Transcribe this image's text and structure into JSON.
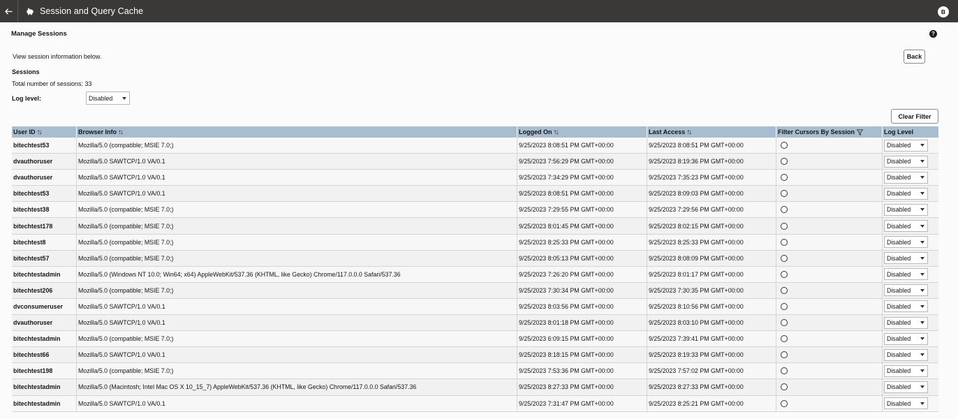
{
  "header": {
    "title": "Session and Query Cache",
    "avatar": "B"
  },
  "page": {
    "heading": "Manage Sessions",
    "intro": "View session information below.",
    "back_label": "Back",
    "sessions_heading": "Sessions",
    "total_text": "Total number of sessions: 33",
    "log_level_label": "Log level:",
    "log_level_value": "Disabled",
    "clear_filter_label": "Clear Filter"
  },
  "table": {
    "columns": [
      "User ID",
      "Browser Info",
      "Logged On",
      "Last Access",
      "Filter Cursors By Session",
      "Log Level"
    ],
    "rows": [
      {
        "user": "bitechtest53",
        "browser": "Mozilla/5.0 (compatible; MSIE 7.0;)",
        "logged_on": "9/25/2023 8:08:51 PM GMT+00:00",
        "last_access": "9/25/2023 8:08:51 PM GMT+00:00",
        "log_level": "Disabled"
      },
      {
        "user": "dvauthoruser",
        "browser": "Mozilla/5.0 SAWTCP/1.0 VA/0.1",
        "logged_on": "9/25/2023 7:56:29 PM GMT+00:00",
        "last_access": "9/25/2023 8:19:36 PM GMT+00:00",
        "log_level": "Disabled"
      },
      {
        "user": "dvauthoruser",
        "browser": "Mozilla/5.0 SAWTCP/1.0 VA/0.1",
        "logged_on": "9/25/2023 7:34:29 PM GMT+00:00",
        "last_access": "9/25/2023 7:35:23 PM GMT+00:00",
        "log_level": "Disabled"
      },
      {
        "user": "bitechtest53",
        "browser": "Mozilla/5.0 SAWTCP/1.0 VA/0.1",
        "logged_on": "9/25/2023 8:08:51 PM GMT+00:00",
        "last_access": "9/25/2023 8:09:03 PM GMT+00:00",
        "log_level": "Disabled"
      },
      {
        "user": "bitechtest38",
        "browser": "Mozilla/5.0 (compatible; MSIE 7.0;)",
        "logged_on": "9/25/2023 7:29:55 PM GMT+00:00",
        "last_access": "9/25/2023 7:29:56 PM GMT+00:00",
        "log_level": "Disabled"
      },
      {
        "user": "bitechtest178",
        "browser": "Mozilla/5.0 (compatible; MSIE 7.0;)",
        "logged_on": "9/25/2023 8:01:45 PM GMT+00:00",
        "last_access": "9/25/2023 8:02:15 PM GMT+00:00",
        "log_level": "Disabled"
      },
      {
        "user": "bitechtest8",
        "browser": "Mozilla/5.0 (compatible; MSIE 7.0;)",
        "logged_on": "9/25/2023 8:25:33 PM GMT+00:00",
        "last_access": "9/25/2023 8:25:33 PM GMT+00:00",
        "log_level": "Disabled"
      },
      {
        "user": "bitechtest57",
        "browser": "Mozilla/5.0 (compatible; MSIE 7.0;)",
        "logged_on": "9/25/2023 8:05:13 PM GMT+00:00",
        "last_access": "9/25/2023 8:08:09 PM GMT+00:00",
        "log_level": "Disabled"
      },
      {
        "user": "bitechtestadmin",
        "browser": "Mozilla/5.0 (Windows NT 10.0; Win64; x64) AppleWebKit/537.36 (KHTML, like Gecko) Chrome/117.0.0.0 Safari/537.36",
        "logged_on": "9/25/2023 7:26:20 PM GMT+00:00",
        "last_access": "9/25/2023 8:01:17 PM GMT+00:00",
        "log_level": "Disabled"
      },
      {
        "user": "bitechtest206",
        "browser": "Mozilla/5.0 (compatible; MSIE 7.0;)",
        "logged_on": "9/25/2023 7:30:34 PM GMT+00:00",
        "last_access": "9/25/2023 7:30:35 PM GMT+00:00",
        "log_level": "Disabled"
      },
      {
        "user": "dvconsumeruser",
        "browser": "Mozilla/5.0 SAWTCP/1.0 VA/0.1",
        "logged_on": "9/25/2023 8:03:56 PM GMT+00:00",
        "last_access": "9/25/2023 8:10:56 PM GMT+00:00",
        "log_level": "Disabled"
      },
      {
        "user": "dvauthoruser",
        "browser": "Mozilla/5.0 SAWTCP/1.0 VA/0.1",
        "logged_on": "9/25/2023 8:01:18 PM GMT+00:00",
        "last_access": "9/25/2023 8:03:10 PM GMT+00:00",
        "log_level": "Disabled"
      },
      {
        "user": "bitechtestadmin",
        "browser": "Mozilla/5.0 (compatible; MSIE 7.0;)",
        "logged_on": "9/25/2023 6:09:15 PM GMT+00:00",
        "last_access": "9/25/2023 7:39:41 PM GMT+00:00",
        "log_level": "Disabled"
      },
      {
        "user": "bitechtest66",
        "browser": "Mozilla/5.0 SAWTCP/1.0 VA/0.1",
        "logged_on": "9/25/2023 8:18:15 PM GMT+00:00",
        "last_access": "9/25/2023 8:19:33 PM GMT+00:00",
        "log_level": "Disabled"
      },
      {
        "user": "bitechtest198",
        "browser": "Mozilla/5.0 (compatible; MSIE 7.0;)",
        "logged_on": "9/25/2023 7:53:36 PM GMT+00:00",
        "last_access": "9/25/2023 7:57:02 PM GMT+00:00",
        "log_level": "Disabled"
      },
      {
        "user": "bitechtestadmin",
        "browser": "Mozilla/5.0 (Macintosh; Intel Mac OS X 10_15_7) AppleWebKit/537.36 (KHTML, like Gecko) Chrome/117.0.0.0 Safari/537.36",
        "logged_on": "9/25/2023 8:27:33 PM GMT+00:00",
        "last_access": "9/25/2023 8:27:33 PM GMT+00:00",
        "log_level": "Disabled"
      },
      {
        "user": "bitechtestadmin",
        "browser": "Mozilla/5.0 SAWTCP/1.0 VA/0.1",
        "logged_on": "9/25/2023 7:31:47 PM GMT+00:00",
        "last_access": "9/25/2023 8:25:21 PM GMT+00:00",
        "log_level": "Disabled"
      }
    ]
  }
}
